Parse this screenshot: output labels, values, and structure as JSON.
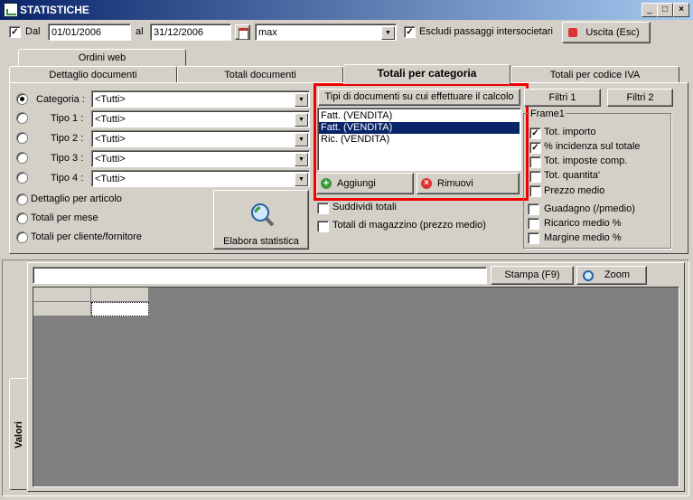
{
  "window": {
    "title": "STATISTICHE",
    "min": "_",
    "max": "□",
    "close": "×"
  },
  "header": {
    "dal_label": "Dal",
    "dal_value": "01/01/2006",
    "al_label": "al",
    "al_value": "31/12/2006",
    "mode_value": "max",
    "escludi_label": "Escludi passaggi intersocietari",
    "exit_label": "Uscita (Esc)"
  },
  "tabs": {
    "row1": [
      "Ordini web"
    ],
    "row2": [
      "Dettaglio documenti",
      "Totali documenti",
      "Totali per categoria",
      "Totali per codice IVA"
    ],
    "active": "Totali per categoria"
  },
  "filters": {
    "rows": [
      {
        "label": "Categoria :",
        "value": "<Tutti>",
        "selected": true
      },
      {
        "label": "Tipo 1 :",
        "value": "<Tutti>",
        "selected": false
      },
      {
        "label": "Tipo 2 :",
        "value": "<Tutti>",
        "selected": false
      },
      {
        "label": "Tipo 3 :",
        "value": "<Tutti>",
        "selected": false
      },
      {
        "label": "Tipo 4 :",
        "value": "<Tutti>",
        "selected": false
      }
    ],
    "options": [
      "Dettaglio per articolo",
      "Totali per mese",
      "Totali per cliente/fornitore"
    ],
    "elabora_label": "Elabora statistica"
  },
  "doc_types": {
    "header": "Tipi di documenti su cui effettuare il calcolo",
    "items": [
      "Fatt. (VENDITA)",
      "Fatt. (VENDITA)",
      "Ric. (VENDITA)"
    ],
    "selected_index": 1,
    "add_label": "Aggiungi",
    "remove_label": "Rimuovi",
    "suddividi_label": "Suddividi totali",
    "magazzino_label": "Totali di magazzino (prezzo medio)"
  },
  "right_panel": {
    "filtri1": "Filtri 1",
    "filtri2": "Filtri 2",
    "frame_title": "Frame1",
    "checks": [
      {
        "label": "Tot. importo",
        "checked": true
      },
      {
        "label": "% incidenza sul totale",
        "checked": true
      },
      {
        "label": "Tot. imposte comp.",
        "checked": false
      },
      {
        "label": "Tot. quantita'",
        "checked": false
      },
      {
        "label": "Prezzo medio",
        "checked": false
      },
      {
        "label": "Guadagno (/pmedio)",
        "checked": false
      },
      {
        "label": "Ricarico medio %",
        "checked": false
      },
      {
        "label": "Margine medio %",
        "checked": false
      }
    ]
  },
  "results": {
    "side_tab": "Valori",
    "stampa_label": "Stampa (F9)",
    "zoom_label": "Zoom",
    "search_value": ""
  }
}
